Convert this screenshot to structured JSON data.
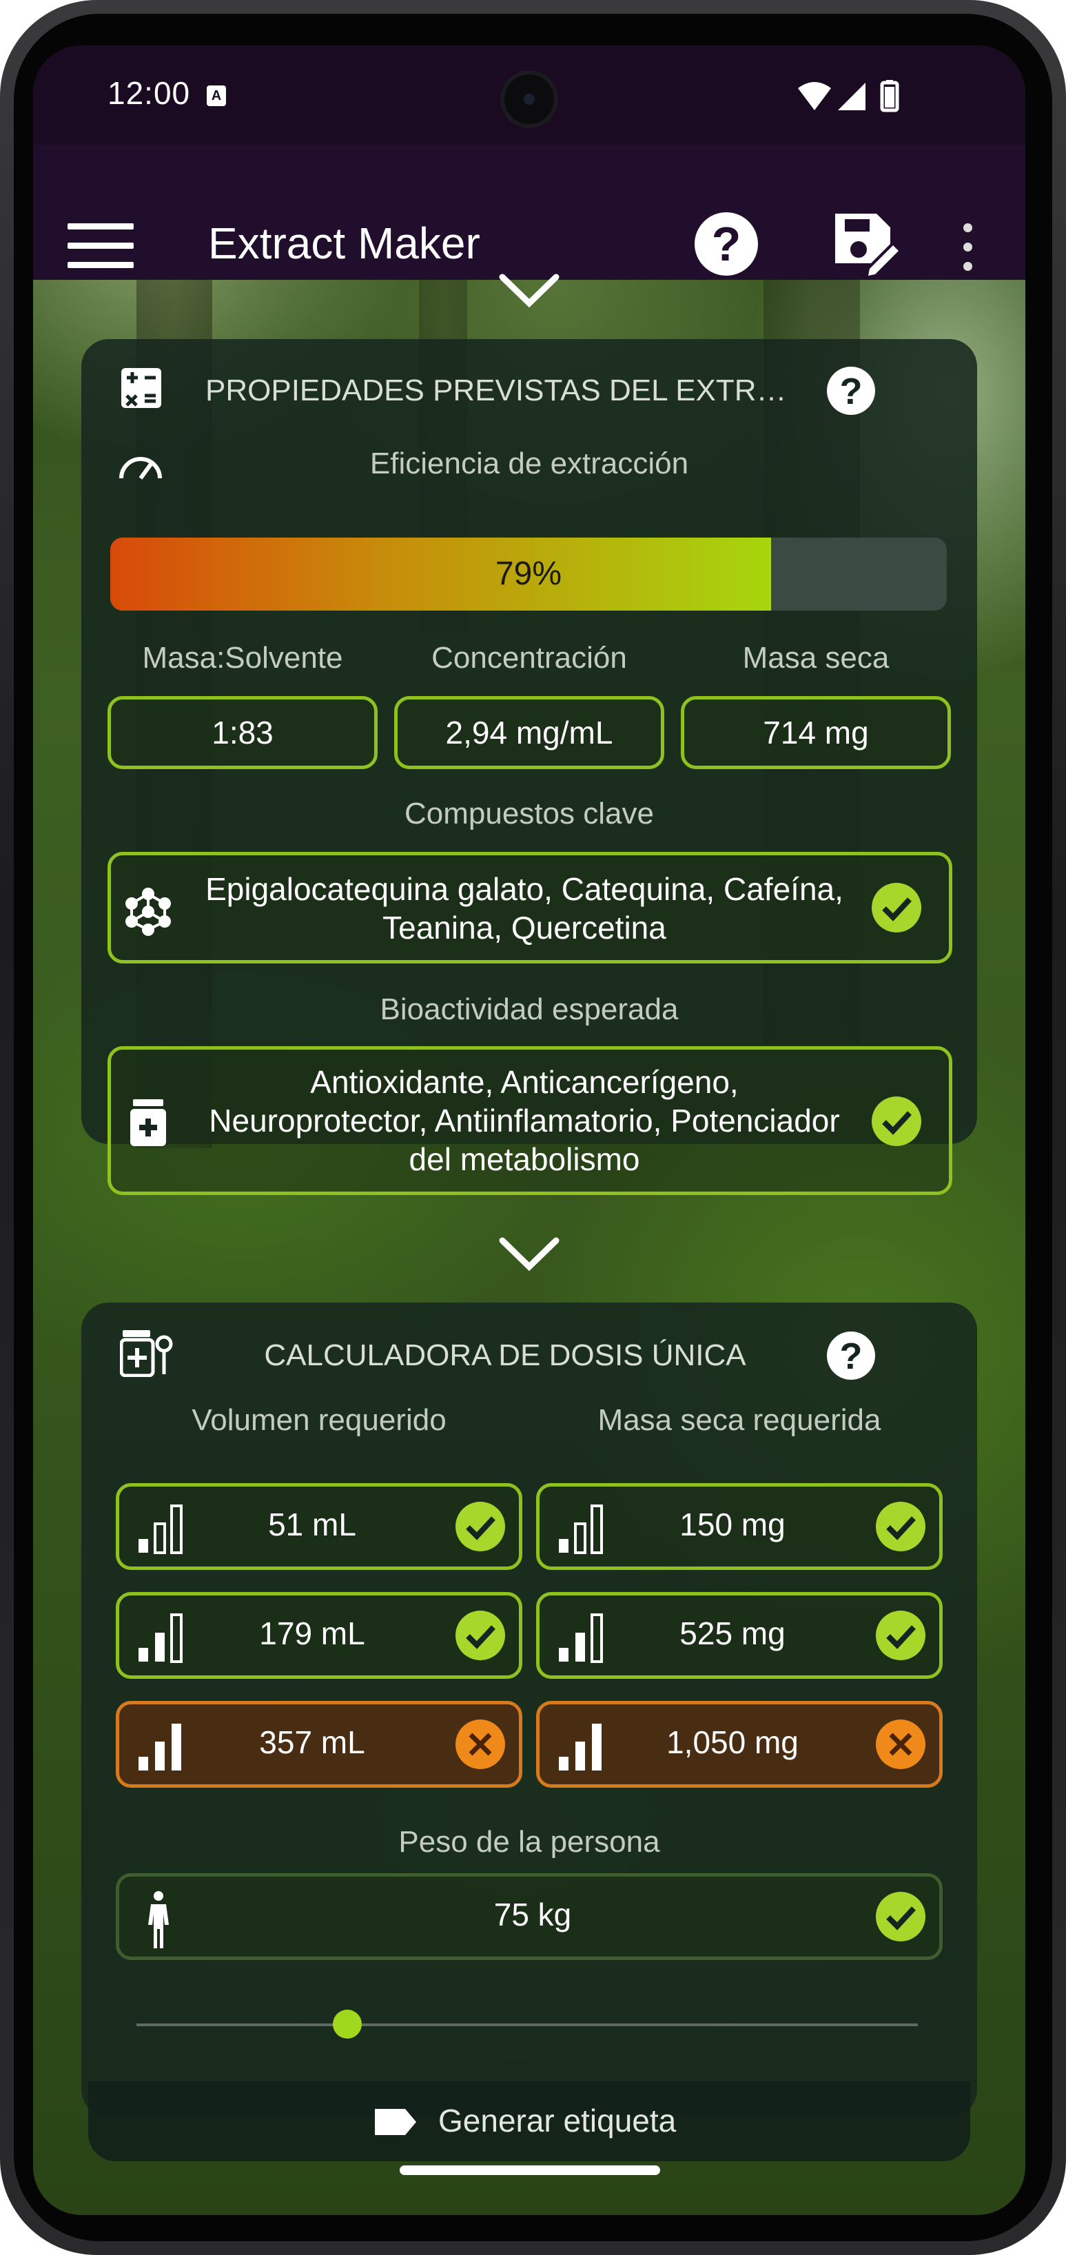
{
  "status_bar": {
    "time": "12:00",
    "notification_icon": "a-box-icon",
    "icons": [
      "wifi-icon",
      "signal-icon",
      "battery-icon"
    ]
  },
  "app_bar": {
    "title": "Extract Maker",
    "icons": [
      "menu-icon",
      "help-icon",
      "save-edit-icon",
      "more-vert-icon"
    ]
  },
  "properties_card": {
    "title": "PROPIEDADES PREVISTAS DEL EXTRAC...",
    "efficiency_label": "Eficiencia de extracción",
    "efficiency_value": "79%",
    "efficiency_fraction": 0.79,
    "stats": [
      {
        "label": "Masa:Solvente",
        "value": "1:83"
      },
      {
        "label": "Concentración",
        "value": "2,94 mg/mL"
      },
      {
        "label": "Masa seca",
        "value": "714 mg"
      }
    ],
    "key_compounds_label": "Compuestos clave",
    "key_compounds_line1": "Epigalocatequina galato, Catequina, Cafeína,",
    "key_compounds_line2": "Teanina, Quercetina",
    "bioactivity_label": "Bioactividad esperada",
    "bioactivity_line1": "Antioxidante, Anticancerígeno,",
    "bioactivity_line2": "Neuroprotector, Antiinflamatorio, Potenciador",
    "bioactivity_line3": "del metabolismo"
  },
  "dose_card": {
    "title": "CALCULADORA DE DOSIS ÚNICA",
    "volume_label": "Volumen requerido",
    "mass_label": "Masa seca requerida",
    "rows": [
      {
        "volume": "51 mL",
        "mass": "150 mg",
        "status": "ok",
        "level": 1
      },
      {
        "volume": "179 mL",
        "mass": "525 mg",
        "status": "ok",
        "level": 2
      },
      {
        "volume": "357 mL",
        "mass": "1,050 mg",
        "status": "warning",
        "level": 3
      }
    ],
    "weight_label": "Peso de la persona",
    "weight_value": "75 kg",
    "weight_slider_fraction": 0.27,
    "generate_label": "Generar etiqueta"
  },
  "colors": {
    "accent": "#8fc21f",
    "warning": "#d67a1e",
    "appbar": "#210d2c"
  }
}
